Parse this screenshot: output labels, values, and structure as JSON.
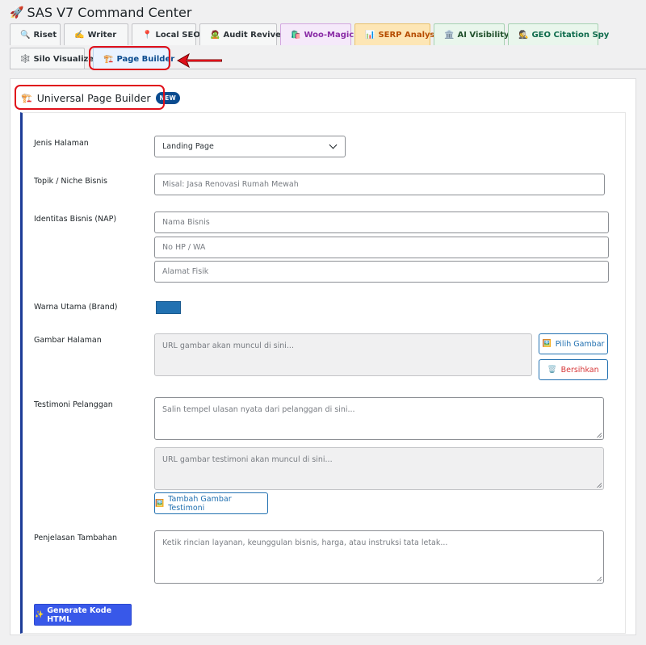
{
  "app": {
    "title": "SAS V7 Command Center",
    "title_icon": "🚀"
  },
  "tabs_row1": [
    {
      "icon": "🔍",
      "label": "Riset"
    },
    {
      "icon": "✍️",
      "label": "Writer"
    },
    {
      "icon": "📍",
      "label": "Local SEO"
    },
    {
      "icon": "🧟",
      "label": "Audit Reviver"
    },
    {
      "icon": "🛍️",
      "label": "Woo-Magic"
    },
    {
      "icon": "📊",
      "label": "SERP Analyst"
    },
    {
      "icon": "🏛️",
      "label": "AI Visibility"
    },
    {
      "icon": "🕵️",
      "label": "GEO Citation Spy"
    }
  ],
  "tabs_row2": [
    {
      "icon": "🕸️",
      "label": "Silo Visualizer"
    },
    {
      "icon": "🏗️",
      "label": "Page Builder",
      "active": true
    }
  ],
  "section": {
    "icon": "🏗️",
    "title": "Universal Page Builder",
    "badge": "NEW"
  },
  "form": {
    "page_type": {
      "label": "Jenis Halaman",
      "value": "Landing Page"
    },
    "topic": {
      "label": "Topik / Niche Bisnis",
      "placeholder": "Misal: Jasa Renovasi Rumah Mewah"
    },
    "nap": {
      "label": "Identitas Bisnis (NAP)",
      "name_placeholder": "Nama Bisnis",
      "phone_placeholder": "No HP / WA",
      "address_placeholder": "Alamat Fisik"
    },
    "brand_color": {
      "label": "Warna Utama (Brand)",
      "value": "#2271b1"
    },
    "page_image": {
      "label": "Gambar Halaman",
      "placeholder": "URL gambar akan muncul di sini...",
      "pick_label": "Pilih Gambar",
      "pick_icon": "🖼️",
      "clear_label": "Bersihkan",
      "clear_icon": "🗑️"
    },
    "testimonial": {
      "label": "Testimoni Pelanggan",
      "placeholder": "Salin tempel ulasan nyata dari pelanggan di sini...",
      "image_placeholder": "URL gambar testimoni akan muncul di sini...",
      "add_label": "Tambah Gambar Testimoni",
      "add_icon": "🖼️"
    },
    "extra": {
      "label": "Penjelasan Tambahan",
      "placeholder": "Ketik rincian layanan, keunggulan bisnis, harga, atau instruksi tata letak..."
    },
    "generate": {
      "icon": "✨",
      "label": "Generate Kode HTML"
    }
  }
}
